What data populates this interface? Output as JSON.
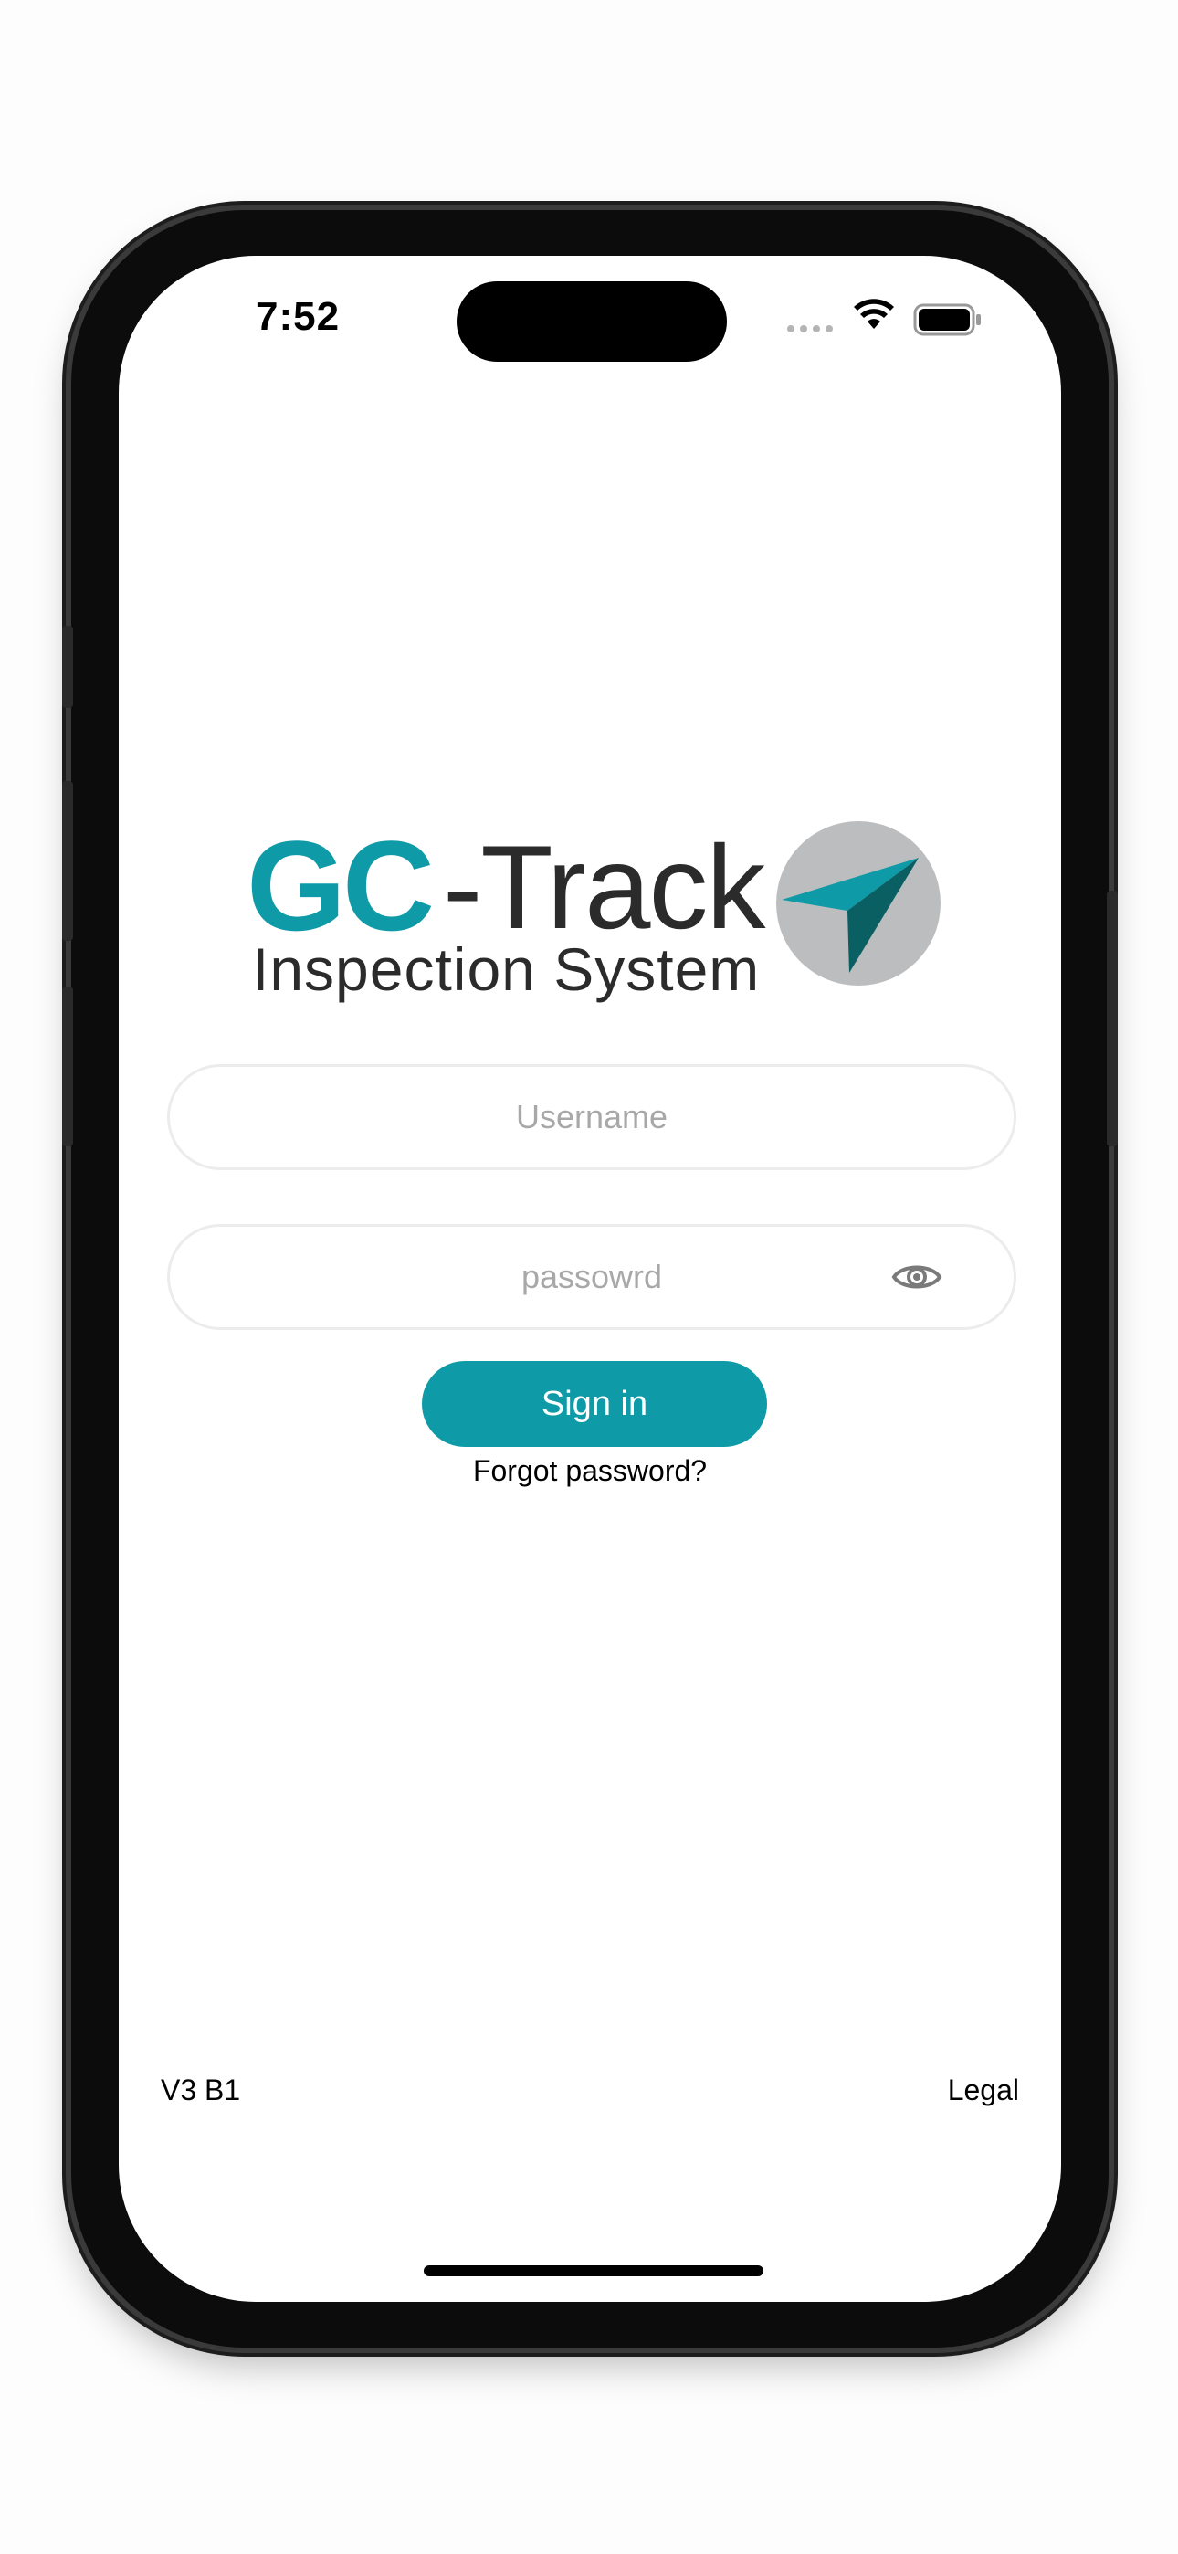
{
  "status_bar": {
    "time": "7:52",
    "icons": [
      "signal-dots-icon",
      "wifi-icon",
      "battery-icon"
    ]
  },
  "logo": {
    "brand_prefix": "GC",
    "brand_suffix": "-Track",
    "tagline": "Inspection System",
    "icon": "navigation-arrow-icon",
    "colors": {
      "teal": "#0e9aa7",
      "dark_teal": "#0a5f63",
      "gray": "#bcbdbf",
      "text": "#2b2b2b"
    }
  },
  "login_form": {
    "username": {
      "value": "",
      "placeholder": "Username"
    },
    "password": {
      "value": "",
      "placeholder": "passowrd",
      "toggle_icon": "eye-icon"
    },
    "submit_label": "Sign in",
    "forgot_label": "Forgot password?"
  },
  "footer": {
    "version": "V3 B1",
    "legal_label": "Legal"
  },
  "theme": {
    "accent": "#0e9aa7",
    "background": "#ffffff"
  }
}
